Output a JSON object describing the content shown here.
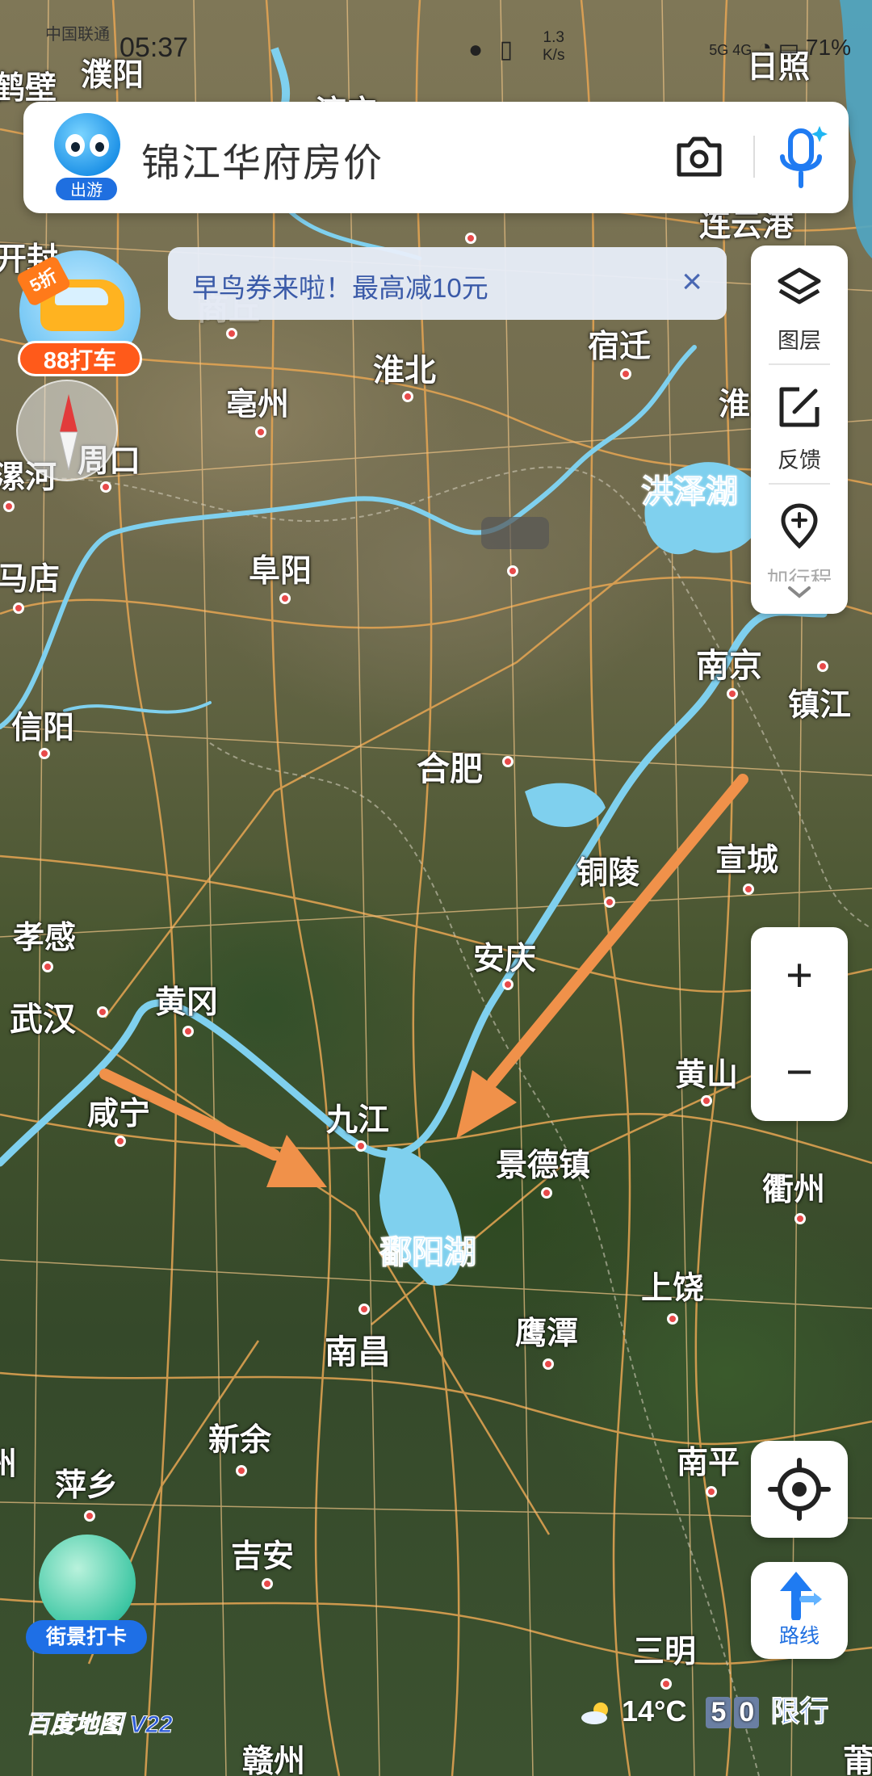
{
  "status_bar": {
    "carrier": "中国联通",
    "time": "05:37",
    "speed": "1.3",
    "speed_unit": "K/s",
    "signal": "5G 4G",
    "battery": "71%",
    "city_corner": "日照"
  },
  "search": {
    "mascot_label": "出游",
    "query": "锦江华府房价"
  },
  "promo": {
    "text": "早鸟券来啦！最高减10元",
    "close": "×"
  },
  "taxi": {
    "discount": "5折",
    "label": "88打车"
  },
  "side_panel": {
    "items": [
      {
        "label": "图层",
        "icon": "layers-icon"
      },
      {
        "label": "反馈",
        "icon": "feedback-icon"
      },
      {
        "label": "加行程",
        "icon": "add-trip-pin-icon"
      }
    ]
  },
  "zoom": {
    "in": "+",
    "out": "−"
  },
  "route": {
    "label": "路线"
  },
  "street_view": {
    "label": "街景打卡"
  },
  "footer": {
    "logo": "百度地图 V22",
    "temperature": "14°C",
    "plate_numbers": [
      "5",
      "0"
    ],
    "limit_label": "限行"
  },
  "map": {
    "cities": [
      {
        "name": "濮阳"
      },
      {
        "name": "鹤壁"
      },
      {
        "name": "济宁"
      },
      {
        "name": "日照"
      },
      {
        "name": "开封"
      },
      {
        "name": "连云港"
      },
      {
        "name": "商丘"
      },
      {
        "name": "宿迁"
      },
      {
        "name": "淮北"
      },
      {
        "name": "亳州"
      },
      {
        "name": "周口"
      },
      {
        "name": "漯河"
      },
      {
        "name": "淮"
      },
      {
        "name": "阜阳"
      },
      {
        "name": "马店"
      },
      {
        "name": "南京"
      },
      {
        "name": "镇江"
      },
      {
        "name": "信阳"
      },
      {
        "name": "合肥"
      },
      {
        "name": "铜陵"
      },
      {
        "name": "宣城"
      },
      {
        "name": "孝感"
      },
      {
        "name": "安庆"
      },
      {
        "name": "黄冈"
      },
      {
        "name": "武汉"
      },
      {
        "name": "黄山"
      },
      {
        "name": "咸宁"
      },
      {
        "name": "九江"
      },
      {
        "name": "景德镇"
      },
      {
        "name": "衢州"
      },
      {
        "name": "上饶"
      },
      {
        "name": "南昌"
      },
      {
        "name": "鹰潭"
      },
      {
        "name": "新余"
      },
      {
        "name": "萍乡"
      },
      {
        "name": "南平"
      },
      {
        "name": "吉安"
      },
      {
        "name": "三明"
      },
      {
        "name": "赣州"
      },
      {
        "name": "莆"
      },
      {
        "name": "州"
      }
    ],
    "lakes": [
      {
        "name": "洪泽湖"
      },
      {
        "name": "鄱阳湖"
      }
    ]
  }
}
